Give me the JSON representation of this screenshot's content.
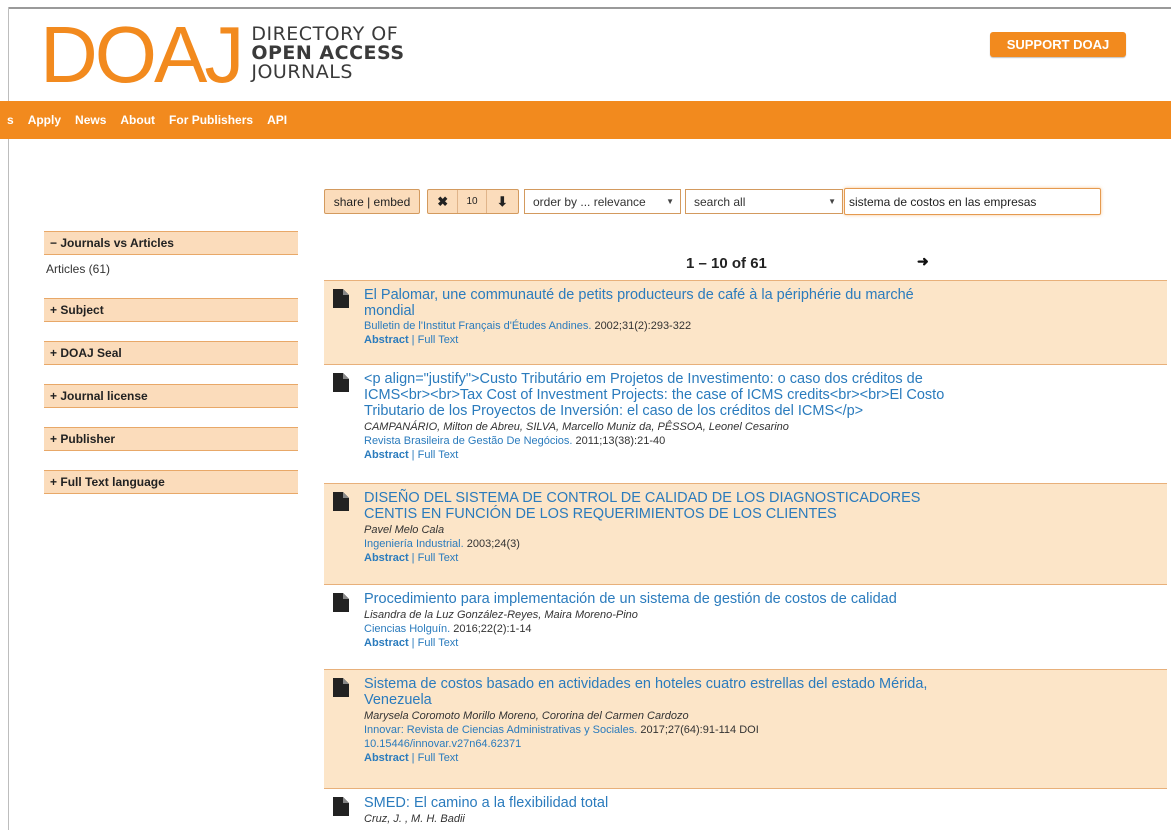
{
  "header": {
    "logo_mark": "DOAJ",
    "logo_line1": "DIRECTORY OF",
    "logo_line2": "OPEN ACCESS",
    "logo_line3": "JOURNALS",
    "support_label": "SUPPORT DOAJ"
  },
  "nav": {
    "lead": "s",
    "items": [
      "Apply",
      "News",
      "About",
      "For Publishers",
      "API"
    ]
  },
  "toolbar": {
    "share_label": "share | embed",
    "clear_glyph": "✖",
    "page_size": "10",
    "download_glyph": "⬇",
    "order_label": "order by ... relevance",
    "field_label": "search all",
    "query": "sistema de costos en las empresas"
  },
  "facets": [
    {
      "label": "Journals vs Articles",
      "sign": "−"
    },
    {
      "label": "Subject",
      "sign": "+"
    },
    {
      "label": "DOAJ Seal",
      "sign": "+"
    },
    {
      "label": "Journal license",
      "sign": "+"
    },
    {
      "label": "Publisher",
      "sign": "+"
    },
    {
      "label": "Full Text language",
      "sign": "+"
    }
  ],
  "facet_selected": "Articles (61)",
  "pager": {
    "range": "1 – 10 of 61",
    "next_glyph": "➜"
  },
  "results": [
    {
      "title": "El Palomar, une communauté de petits producteurs de café à la périphérie du marché mondial",
      "authors": "",
      "journal": "Bulletin de l'Institut Français d'Études Andines.",
      "citation": " 2002;31(2):293-322",
      "doi": "",
      "abstract_label": "Abstract",
      "fulltext_label": "Full Text"
    },
    {
      "title": "<p align=\"justify\">Custo Tributário em Projetos de Investimento: o caso dos créditos de ICMS<br><br>Tax Cost of Investment Projects: the case of ICMS credits<br><br>El Costo Tributario de los Proyectos de Inversión: el caso de los créditos del ICMS</p>",
      "authors": "CAMPANÁRIO, Milton de Abreu, SILVA, Marcello Muniz da, PÊSSOA, Leonel Cesarino",
      "journal": "Revista Brasileira de Gestão De Negócios.",
      "citation": " 2011;13(38):21-40",
      "doi": "",
      "abstract_label": "Abstract",
      "fulltext_label": "Full Text"
    },
    {
      "title": "DISEÑO DEL SISTEMA DE CONTROL DE CALIDAD DE LOS DIAGNOSTICADORES CENTIS EN FUNCIÓN DE LOS REQUERIMIENTOS DE LOS CLIENTES",
      "authors": "Pavel Melo Cala",
      "journal": "Ingeniería Industrial.",
      "citation": " 2003;24(3)",
      "doi": "",
      "abstract_label": "Abstract",
      "fulltext_label": "Full Text"
    },
    {
      "title": "Procedimiento para implementación de un sistema de gestión de costos de calidad",
      "authors": "Lisandra de la Luz González-Reyes, Maira Moreno-Pino",
      "journal": "Ciencias Holguín.",
      "citation": " 2016;22(2):1-14",
      "doi": "",
      "abstract_label": "Abstract",
      "fulltext_label": "Full Text"
    },
    {
      "title": "Sistema de costos basado en actividades en hoteles cuatro estrellas del estado Mérida, Venezuela",
      "authors": "Marysela Coromoto Morillo Moreno, Cororina del Carmen Cardozo",
      "journal": "Innovar: Revista de Ciencias Administrativas y Sociales.",
      "citation": " 2017;27(64):91-114 DOI",
      "doi": "10.15446/innovar.v27n64.62371",
      "abstract_label": "Abstract",
      "fulltext_label": "Full Text"
    },
    {
      "title": "SMED: El camino a la flexibilidad total",
      "authors": "Cruz, J. , M. H. Badii",
      "journal": "",
      "citation": "",
      "doi": "",
      "abstract_label": "",
      "fulltext_label": ""
    }
  ],
  "colors": {
    "brand_orange": "#f28a1e",
    "highlight_row": "#fce5c8",
    "link_blue": "#2a7bbd"
  }
}
